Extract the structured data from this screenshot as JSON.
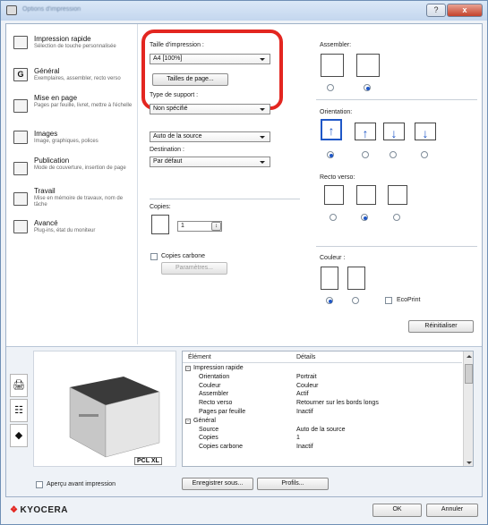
{
  "window": {
    "title": "Options d'impression",
    "help_label": "?",
    "close_label": "x"
  },
  "nav": {
    "items": [
      {
        "title": "Impression rapide",
        "sub": "Sélection de touche personnalisée"
      },
      {
        "title": "Général",
        "sub": "Exemplaires, assembler, recto verso"
      },
      {
        "title": "Mise en page",
        "sub": "Pages par feuille, livret, mettre à l'échelle"
      },
      {
        "title": "Images",
        "sub": "Image, graphiques, polices"
      },
      {
        "title": "Publication",
        "sub": "Mode de couverture, insertion de page"
      },
      {
        "title": "Travail",
        "sub": "Mise en mémoire de travaux, nom de tâche"
      },
      {
        "title": "Avancé",
        "sub": "Plug-ins, état du moniteur"
      }
    ]
  },
  "settings": {
    "print_size_label": "Taille d'impression :",
    "print_size_value": "A4 [100%]",
    "page_sizes_button": "Tailles de page...",
    "media_type_label": "Type de support :",
    "media_type_value": "Non spécifié",
    "source_value": "Auto de la source",
    "destination_label": "Destination :",
    "destination_value": "Par défaut",
    "copies_label": "Copies:",
    "copies_value": "1",
    "carbon_label": "Copies carbone",
    "parameters_button": "Paramètres...",
    "collate_label": "Assembler:",
    "orientation_label": "Orientation:",
    "duplex_label": "Recto verso:",
    "color_label": "Couleur :",
    "ecoprint_label": "EcoPrint",
    "reset_button": "Réinitialiser"
  },
  "preview": {
    "pcl_badge": "PCL XL",
    "col_element": "Élément",
    "col_details": "Détails",
    "rows": [
      {
        "k": "Impression rapide",
        "v": "",
        "group": true
      },
      {
        "k": "Orientation",
        "v": "Portrait",
        "group": false
      },
      {
        "k": "Couleur",
        "v": "Couleur",
        "group": false
      },
      {
        "k": "Assembler",
        "v": "Actif",
        "group": false
      },
      {
        "k": "Recto verso",
        "v": "Retourner sur les bords longs",
        "group": false
      },
      {
        "k": "Pages par feuille",
        "v": "Inactif",
        "group": false
      },
      {
        "k": "Général",
        "v": "",
        "group": true
      },
      {
        "k": "Source",
        "v": "Auto de la source",
        "group": false
      },
      {
        "k": "Copies",
        "v": "1",
        "group": false
      },
      {
        "k": "Copies carbone",
        "v": "Inactif",
        "group": false
      }
    ],
    "preview_check_label": "Aperçu avant impression",
    "save_button": "Enregistrer sous...",
    "profiles_button": "Profils..."
  },
  "footer": {
    "logo": "KYOCERA",
    "ok_button": "OK",
    "cancel_button": "Annuler"
  },
  "colors": {
    "accent": "#1f57c7",
    "highlight": "#e32620"
  }
}
